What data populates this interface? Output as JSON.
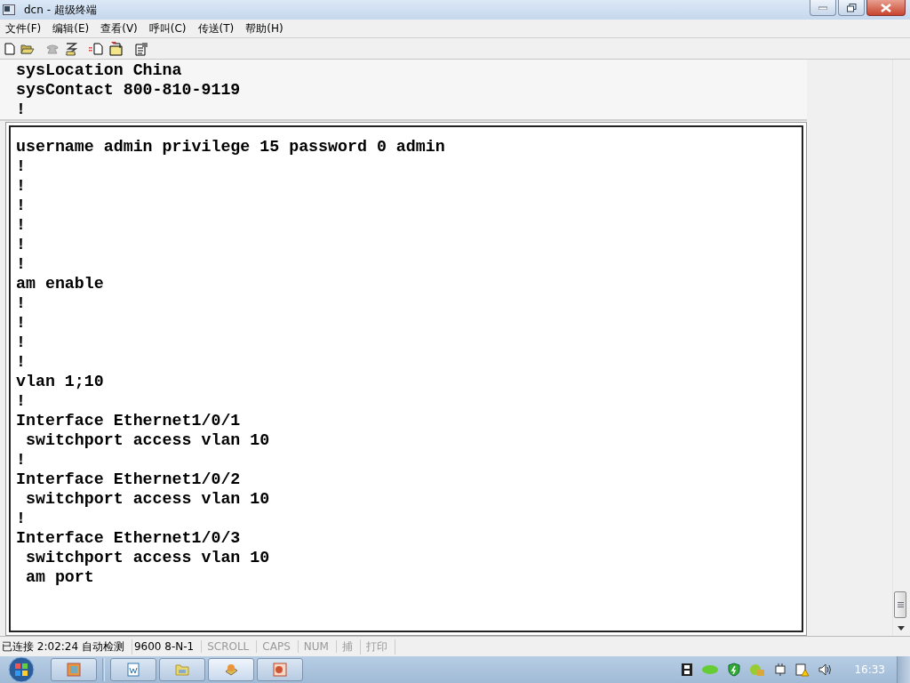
{
  "window": {
    "title": "dcn - 超级终端"
  },
  "menu": [
    "文件(F)",
    "编辑(E)",
    "查看(V)",
    "呼叫(C)",
    "传送(T)",
    "帮助(H)"
  ],
  "terminal": {
    "lines": [
      "sysLocation China",
      "sysContact 800-810-9119",
      "!"
    ]
  },
  "config_window": {
    "lines": [
      "username admin privilege 15 password 0 admin",
      "!",
      "!",
      "!",
      "!",
      "!",
      "!",
      "am enable",
      "!",
      "!",
      "!",
      "!",
      "vlan 1;10",
      "!",
      "Interface Ethernet1/0/1",
      " switchport access vlan 10",
      "!",
      "Interface Ethernet1/0/2",
      " switchport access vlan 10",
      "!",
      "Interface Ethernet1/0/3",
      " switchport access vlan 10",
      " am port"
    ]
  },
  "status_bar": [
    {
      "text": "已连接 2:02:24 自动检测",
      "active": true
    },
    {
      "text": "9600 8-N-1",
      "active": true
    },
    {
      "text": "SCROLL",
      "active": false
    },
    {
      "text": "CAPS",
      "active": false
    },
    {
      "text": "NUM",
      "active": false
    },
    {
      "text": "捕",
      "active": false
    },
    {
      "text": "打印",
      "active": false
    }
  ],
  "taskbar": {
    "clock": "16:33"
  }
}
